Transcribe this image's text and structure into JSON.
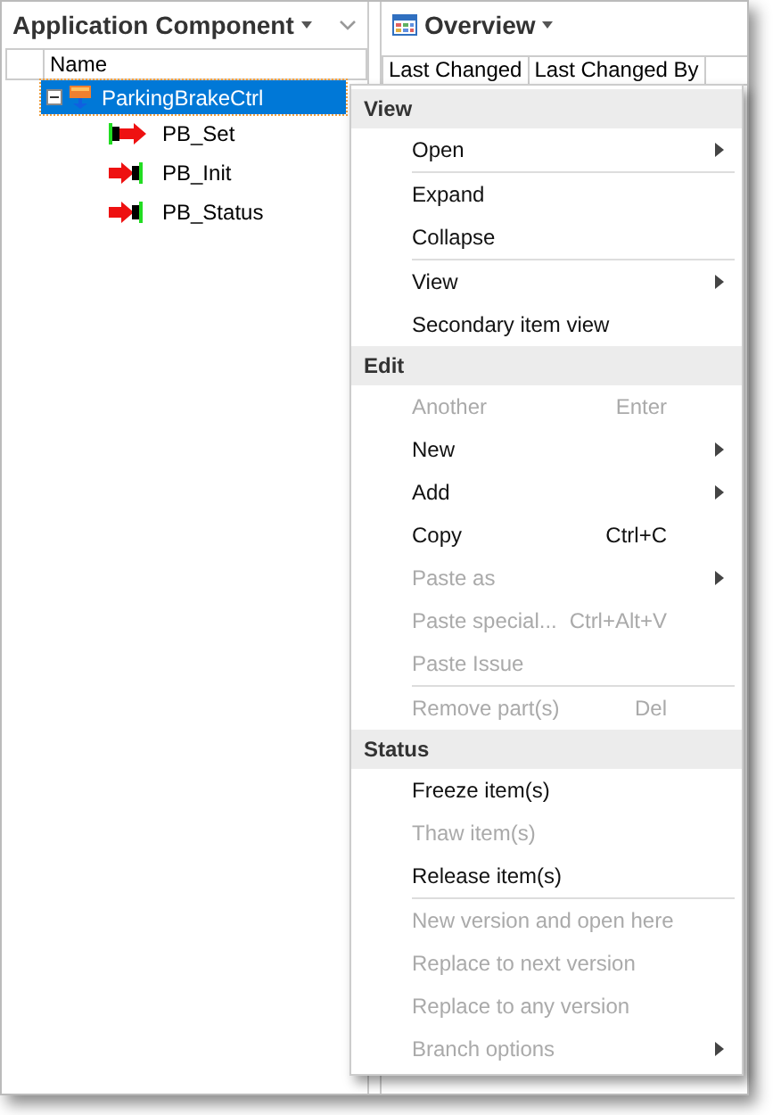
{
  "left_pane": {
    "title": "Application Component",
    "column": "Name",
    "tree": [
      {
        "label": "ParkingBrakeCtrl",
        "kind": "component",
        "selected": true,
        "expanded": true,
        "children": [
          {
            "label": "PB_Set",
            "kind": "port_out",
            "selected": false
          },
          {
            "label": "PB_Init",
            "kind": "port_in",
            "selected": false
          },
          {
            "label": "PB_Status",
            "kind": "port_in",
            "selected": false
          }
        ]
      }
    ]
  },
  "right_pane": {
    "title": "Overview",
    "columns": [
      "Last Changed",
      "Last Changed By"
    ]
  },
  "context_menu": {
    "sections": [
      {
        "title": "View",
        "items": [
          {
            "kind": "item",
            "label": "Open",
            "disabled": false,
            "submenu": true
          },
          {
            "kind": "separator"
          },
          {
            "kind": "item",
            "label": "Expand",
            "disabled": false,
            "submenu": false
          },
          {
            "kind": "item",
            "label": "Collapse",
            "disabled": false,
            "submenu": false
          },
          {
            "kind": "separator"
          },
          {
            "kind": "item",
            "label": "View",
            "disabled": false,
            "submenu": true
          },
          {
            "kind": "item",
            "label": "Secondary item view",
            "disabled": false,
            "submenu": false
          }
        ]
      },
      {
        "title": "Edit",
        "items": [
          {
            "kind": "item",
            "label": "Another",
            "shortcut": "Enter",
            "disabled": true,
            "submenu": false
          },
          {
            "kind": "item",
            "label": "New",
            "disabled": false,
            "submenu": true
          },
          {
            "kind": "item",
            "label": "Add",
            "disabled": false,
            "submenu": true
          },
          {
            "kind": "item",
            "label": "Copy",
            "shortcut": "Ctrl+C",
            "disabled": false,
            "submenu": false
          },
          {
            "kind": "item",
            "label": "Paste as",
            "disabled": true,
            "submenu": true
          },
          {
            "kind": "item",
            "label": "Paste special...",
            "shortcut": "Ctrl+Alt+V",
            "disabled": true,
            "submenu": false
          },
          {
            "kind": "item",
            "label": "Paste Issue",
            "disabled": true,
            "submenu": false
          },
          {
            "kind": "separator"
          },
          {
            "kind": "item",
            "label": "Remove part(s)",
            "shortcut": "Del",
            "disabled": true,
            "submenu": false
          }
        ]
      },
      {
        "title": "Status",
        "items": [
          {
            "kind": "item",
            "label": "Freeze item(s)",
            "disabled": false,
            "submenu": false
          },
          {
            "kind": "item",
            "label": "Thaw item(s)",
            "disabled": true,
            "submenu": false
          },
          {
            "kind": "item",
            "label": "Release item(s)",
            "disabled": false,
            "submenu": false
          },
          {
            "kind": "separator"
          },
          {
            "kind": "item",
            "label": "New version and open here",
            "disabled": true,
            "submenu": false
          },
          {
            "kind": "item",
            "label": "Replace to next version",
            "disabled": true,
            "submenu": false
          },
          {
            "kind": "item",
            "label": "Replace to any version",
            "disabled": true,
            "submenu": false
          },
          {
            "kind": "item",
            "label": "Branch options",
            "disabled": true,
            "submenu": true
          }
        ]
      }
    ]
  }
}
